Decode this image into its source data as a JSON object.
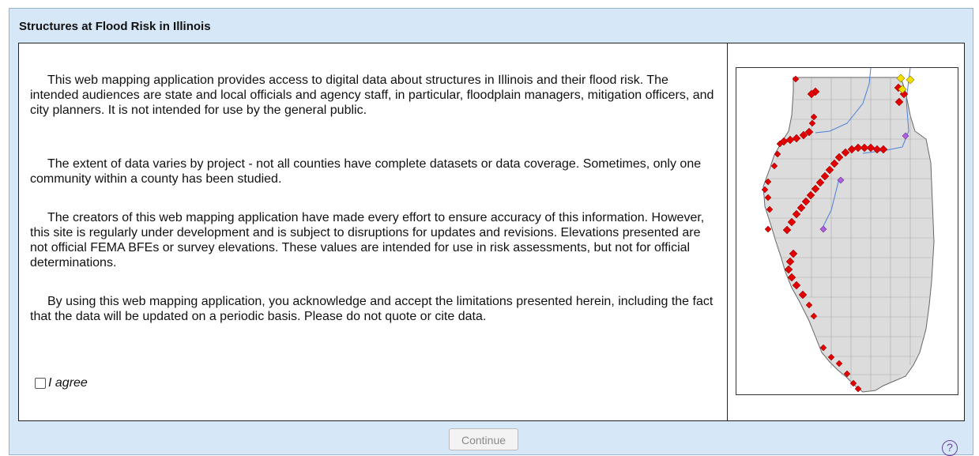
{
  "dialog": {
    "title": "Structures at Flood Risk in Illinois",
    "paragraphs": [
      "This web mapping application provides access to digital data about structures in Illinois and their flood risk. The intended audiences are state and local officials and agency staff, in particular, floodplain managers, mitigation officers, and city planners. It is not intended for use by the general public.",
      "The extent of data varies by project - not all counties have complete datasets or data coverage. Sometimes, only one community within a county has been studied.",
      "The creators of this web mapping application have made every effort to ensure accuracy of this information. However, this site is regularly under development and is subject to disruptions for updates and revisions. Elevations presented are not official FEMA BFEs or survey elevations. These values are intended for use in risk assessments, but not for official determinations.",
      "By using this web mapping application, you acknowledge and accept the limitations presented herein, including the fact that the data will be updated on a periodic basis. Please do not quote or cite data."
    ],
    "agree_label": "I agree",
    "agree_checked": false,
    "continue_label": "Continue",
    "continue_enabled": false,
    "help_glyph": "?"
  },
  "map": {
    "state_fill": "#dcdcdc",
    "marker_colors": {
      "red": "#e00000",
      "yellow": "#f4e000",
      "purple": "#b060e0"
    },
    "river_color": "#4a7fd8"
  }
}
